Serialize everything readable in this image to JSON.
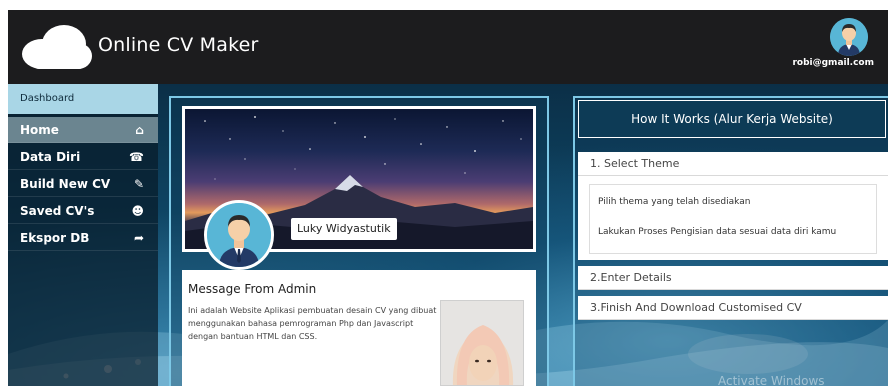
{
  "header": {
    "app_title": "Online CV Maker",
    "user_email": "robi@gmail.com"
  },
  "sidebar": {
    "section_label": "Dashboard",
    "items": [
      {
        "label": "Home",
        "icon": "home-icon",
        "glyph": "⌂"
      },
      {
        "label": "Data Diri",
        "icon": "phone-icon",
        "glyph": "☎"
      },
      {
        "label": "Build New CV",
        "icon": "edit-icon",
        "glyph": "✎"
      },
      {
        "label": "Saved CV's",
        "icon": "user-circle-icon",
        "glyph": "☻"
      },
      {
        "label": "Ekspor DB",
        "icon": "sign-out-icon",
        "glyph": "➦"
      }
    ],
    "active_index": 0
  },
  "profile": {
    "name": "Luky Widyastutik"
  },
  "message": {
    "title": "Message From Admin",
    "body": "Ini adalah Website Aplikasi pembuatan desain CV yang dibuat menggunakan bahasa pemrograman Php dan Javascript dengan bantuan HTML dan CSS."
  },
  "how_it_works": {
    "title": "How It Works (Alur Kerja Website)",
    "steps": [
      {
        "label": "1. Select Theme"
      },
      {
        "label": "2.Enter Details"
      },
      {
        "label": "3.Finish And Download Customised CV"
      }
    ],
    "step1_details": [
      "Pilih thema yang telah disediakan",
      "Lakukan Proses Pengisian data sesuai data diri kamu"
    ]
  },
  "watermark": "Activate Windows",
  "colors": {
    "header_bg": "#1c1c1e",
    "sidebar_active": "#6b8590",
    "dashboard_label_bg": "#a9d6e6",
    "panel_border": "#7dc8e6",
    "how_header_bg": "#0d3b56"
  }
}
